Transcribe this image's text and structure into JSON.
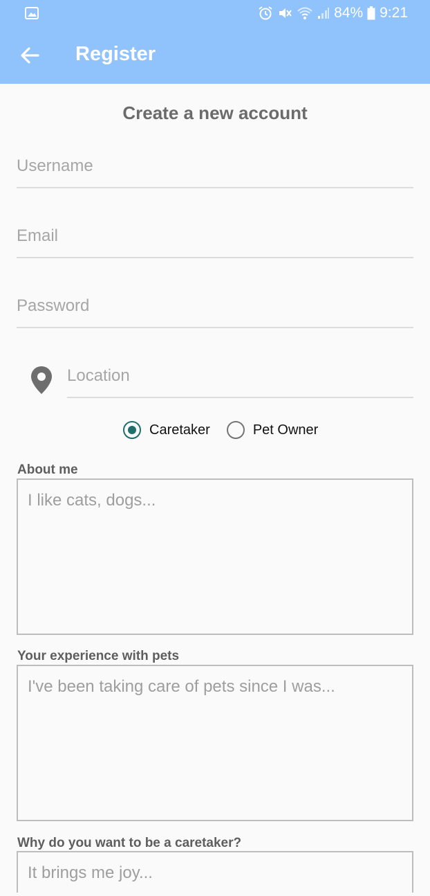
{
  "status_bar": {
    "battery": "84%",
    "time": "9:21",
    "icons": [
      "gallery-icon",
      "alarm-icon",
      "mute-icon",
      "wifi-icon",
      "signal-icon",
      "battery-icon"
    ]
  },
  "app_bar": {
    "title": "Register",
    "back_icon": "arrow-left-icon",
    "color": "#90c2fb"
  },
  "form": {
    "heading": "Create a new account",
    "username_placeholder": "Username",
    "email_placeholder": "Email",
    "password_placeholder": "Password",
    "location_placeholder": "Location",
    "role_options": [
      {
        "label": "Caretaker",
        "selected": true
      },
      {
        "label": "Pet Owner",
        "selected": false
      }
    ],
    "about": {
      "label": "About me",
      "placeholder": "I like cats, dogs..."
    },
    "experience": {
      "label": "Your experience with pets",
      "placeholder": "I've been taking care of pets since I was..."
    },
    "why": {
      "label": "Why do you want to be a caretaker?",
      "placeholder": "It brings me joy..."
    }
  },
  "colors": {
    "accent_radio": "#1f6f6a",
    "heading_text": "#6b6b6b"
  }
}
